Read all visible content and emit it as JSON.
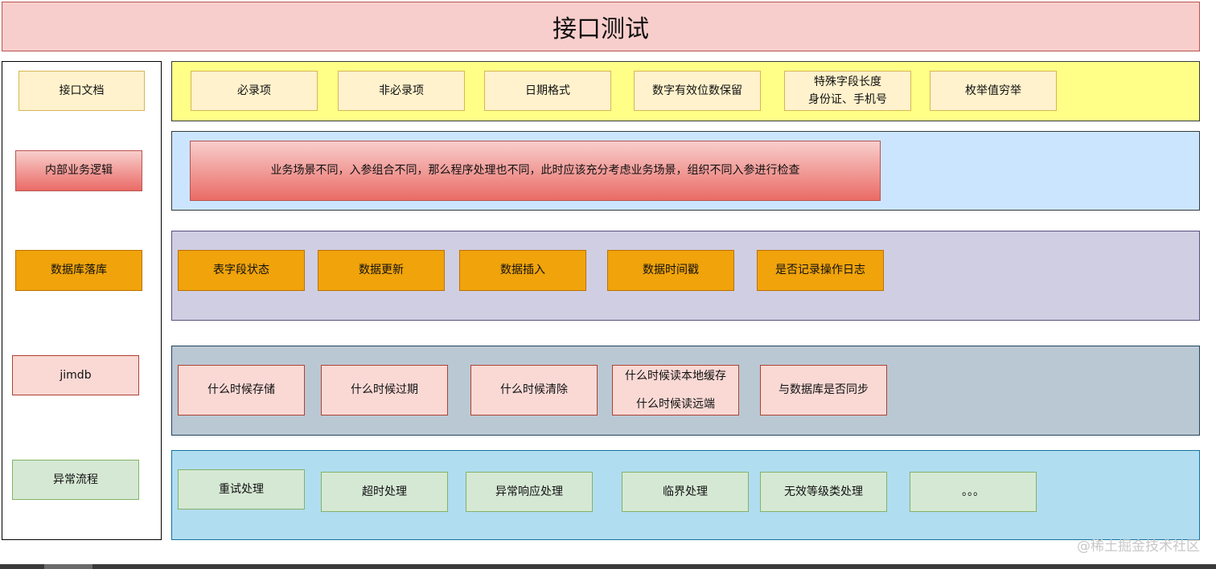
{
  "title": "接口测试",
  "categories": {
    "api_doc": "接口文档",
    "business_logic": "内部业务逻辑",
    "database": "数据库落库",
    "jimdb": "jimdb",
    "exception": "异常流程"
  },
  "rows": {
    "api_doc": [
      "必录项",
      "非必录项",
      "日期格式",
      "数字有效位数保留",
      "特殊字段长度",
      "身份证、手机号",
      "枚举值穷举"
    ],
    "business_logic": [
      "业务场景不同，入参组合不同，那么程序处理也不同，此时应该充分考虑业务场景，组织不同入参进行检查"
    ],
    "database": [
      "表字段状态",
      "数据更新",
      "数据插入",
      "数据时间戳",
      "是否记录操作日志"
    ],
    "jimdb": [
      "什么时候存储",
      "什么时候过期",
      "什么时候清除",
      "什么时候读本地缓存",
      "什么时候读远端",
      "与数据库是否同步"
    ],
    "exception": [
      "重试处理",
      "超时处理",
      "异常响应处理",
      "临界处理",
      "无效等级类处理",
      "。。。"
    ]
  },
  "watermark": "@稀土掘金技术社区"
}
